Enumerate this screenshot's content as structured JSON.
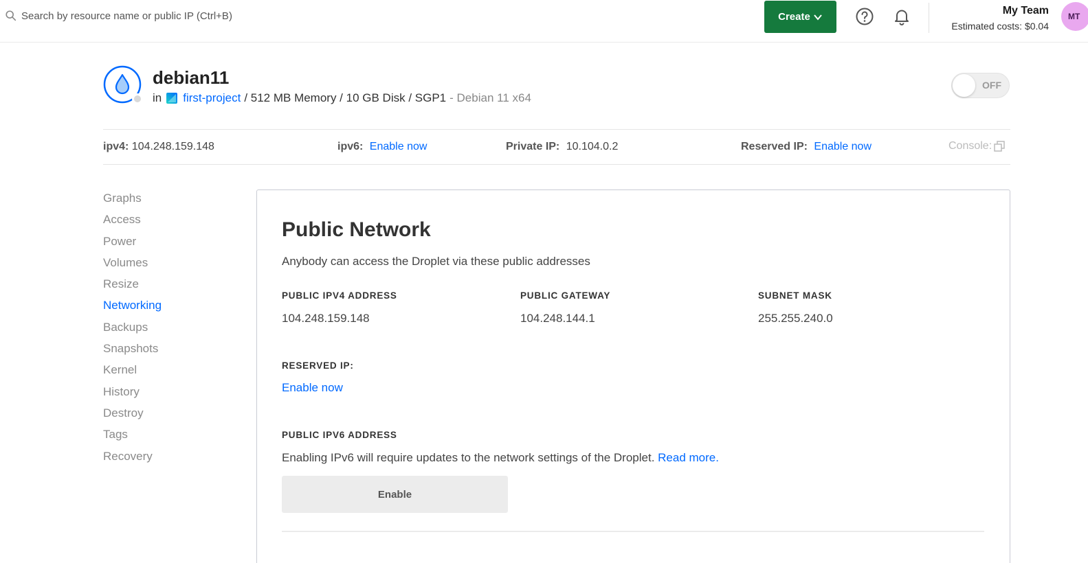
{
  "search": {
    "placeholder": "Search by resource name or public IP (Ctrl+B)"
  },
  "header": {
    "create_label": "Create",
    "team_name": "My Team",
    "estimated_costs": "Estimated costs: $0.04",
    "avatar_initials": "MT"
  },
  "droplet": {
    "name": "debian11",
    "in_label": "in",
    "project": "first-project",
    "specs": "/ 512 MB Memory / 10 GB Disk / SGP1",
    "os": "- Debian 11 x64",
    "power_state": "OFF"
  },
  "infobar": {
    "ipv4_label": "ipv4:",
    "ipv4_value": "104.248.159.148",
    "ipv6_label": "ipv6:",
    "ipv6_link": "Enable now",
    "private_ip_label": "Private IP:",
    "private_ip_value": "10.104.0.2",
    "reserved_ip_label": "Reserved IP:",
    "reserved_ip_link": "Enable now",
    "console_label": "Console:"
  },
  "sidebar": {
    "items": [
      {
        "label": "Graphs",
        "active": false
      },
      {
        "label": "Access",
        "active": false
      },
      {
        "label": "Power",
        "active": false
      },
      {
        "label": "Volumes",
        "active": false
      },
      {
        "label": "Resize",
        "active": false
      },
      {
        "label": "Networking",
        "active": true
      },
      {
        "label": "Backups",
        "active": false
      },
      {
        "label": "Snapshots",
        "active": false
      },
      {
        "label": "Kernel",
        "active": false
      },
      {
        "label": "History",
        "active": false
      },
      {
        "label": "Destroy",
        "active": false
      },
      {
        "label": "Tags",
        "active": false
      },
      {
        "label": "Recovery",
        "active": false
      }
    ]
  },
  "panel": {
    "title": "Public Network",
    "description": "Anybody can access the Droplet via these public addresses",
    "columns": [
      {
        "label": "PUBLIC IPV4 ADDRESS",
        "value": "104.248.159.148"
      },
      {
        "label": "PUBLIC GATEWAY",
        "value": "104.248.144.1"
      },
      {
        "label": "SUBNET MASK",
        "value": "255.255.240.0"
      }
    ],
    "reserved_label": "RESERVED IP:",
    "reserved_link": "Enable now",
    "ipv6_label": "PUBLIC IPV6 ADDRESS",
    "ipv6_desc": "Enabling IPv6 will require updates to the network settings of the Droplet.",
    "ipv6_read_more": "Read more.",
    "enable_button": "Enable"
  },
  "colors": {
    "accent_blue": "#0069ff",
    "create_green": "#157a3d",
    "avatar_pink": "#e9a8ef"
  }
}
